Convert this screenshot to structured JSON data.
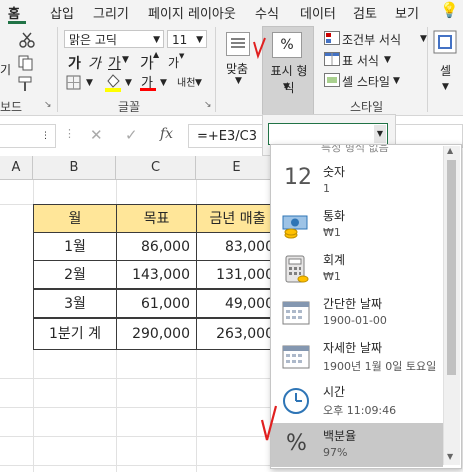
{
  "tabs": [
    "홈",
    "삽입",
    "그리기",
    "페이지 레이아웃",
    "수식",
    "데이터",
    "검토",
    "보기"
  ],
  "clipboard": {
    "cut_partial": "기",
    "label_partial": "보드"
  },
  "font": {
    "name": "맑은 고딕",
    "size": "11",
    "bold_partial": "가",
    "italic_partial": "가",
    "underline_partial": "가",
    "grow": "가",
    "shrink": "가",
    "fill_color": "#ffff00",
    "font_color_label": "가",
    "font_color": "#ff0000",
    "phonetic": "내천",
    "group_label": "글꼴"
  },
  "alignment": {
    "label": "맞춤"
  },
  "number": {
    "label": "표시 형식",
    "icon_text": "%"
  },
  "styles": {
    "conditional": "조건부 서식",
    "table": "표 서식",
    "cell": "셀 스타일",
    "group_label": "스타일"
  },
  "cells_group": {
    "label": "셀"
  },
  "formula": {
    "fx": "fx",
    "value": "=+E3/C3"
  },
  "columns": [
    "A",
    "B",
    "C",
    "E"
  ],
  "table": {
    "headers": [
      "월",
      "목표",
      "금년 매출"
    ],
    "rows": [
      [
        "1월",
        "86,000",
        "83,000"
      ],
      [
        "2월",
        "143,000",
        "131,000"
      ],
      [
        "3월",
        "61,000",
        "49,000"
      ],
      [
        "1분기 계",
        "290,000",
        "263,000"
      ]
    ],
    "header_color": "#ffe699"
  },
  "number_format_dropdown": {
    "cut_top": "특정 형식 없음",
    "options": [
      {
        "title": "숫자",
        "sample": "1",
        "icon": "number-12-icon"
      },
      {
        "title": "통화",
        "sample": "₩1",
        "icon": "currency-icon"
      },
      {
        "title": "회계",
        "sample": "₩1",
        "icon": "accounting-icon"
      },
      {
        "title": "간단한 날짜",
        "sample": "1900-01-00",
        "icon": "calendar-icon"
      },
      {
        "title": "자세한 날짜",
        "sample": "1900년 1월 0일 토요일",
        "icon": "calendar-icon"
      },
      {
        "title": "시간",
        "sample": "오후 11:09:46",
        "icon": "clock-icon"
      },
      {
        "title": "백분율",
        "sample": "97%",
        "icon": "percent-icon"
      }
    ],
    "selected": "백분율"
  },
  "annotation_color": "#e02020"
}
